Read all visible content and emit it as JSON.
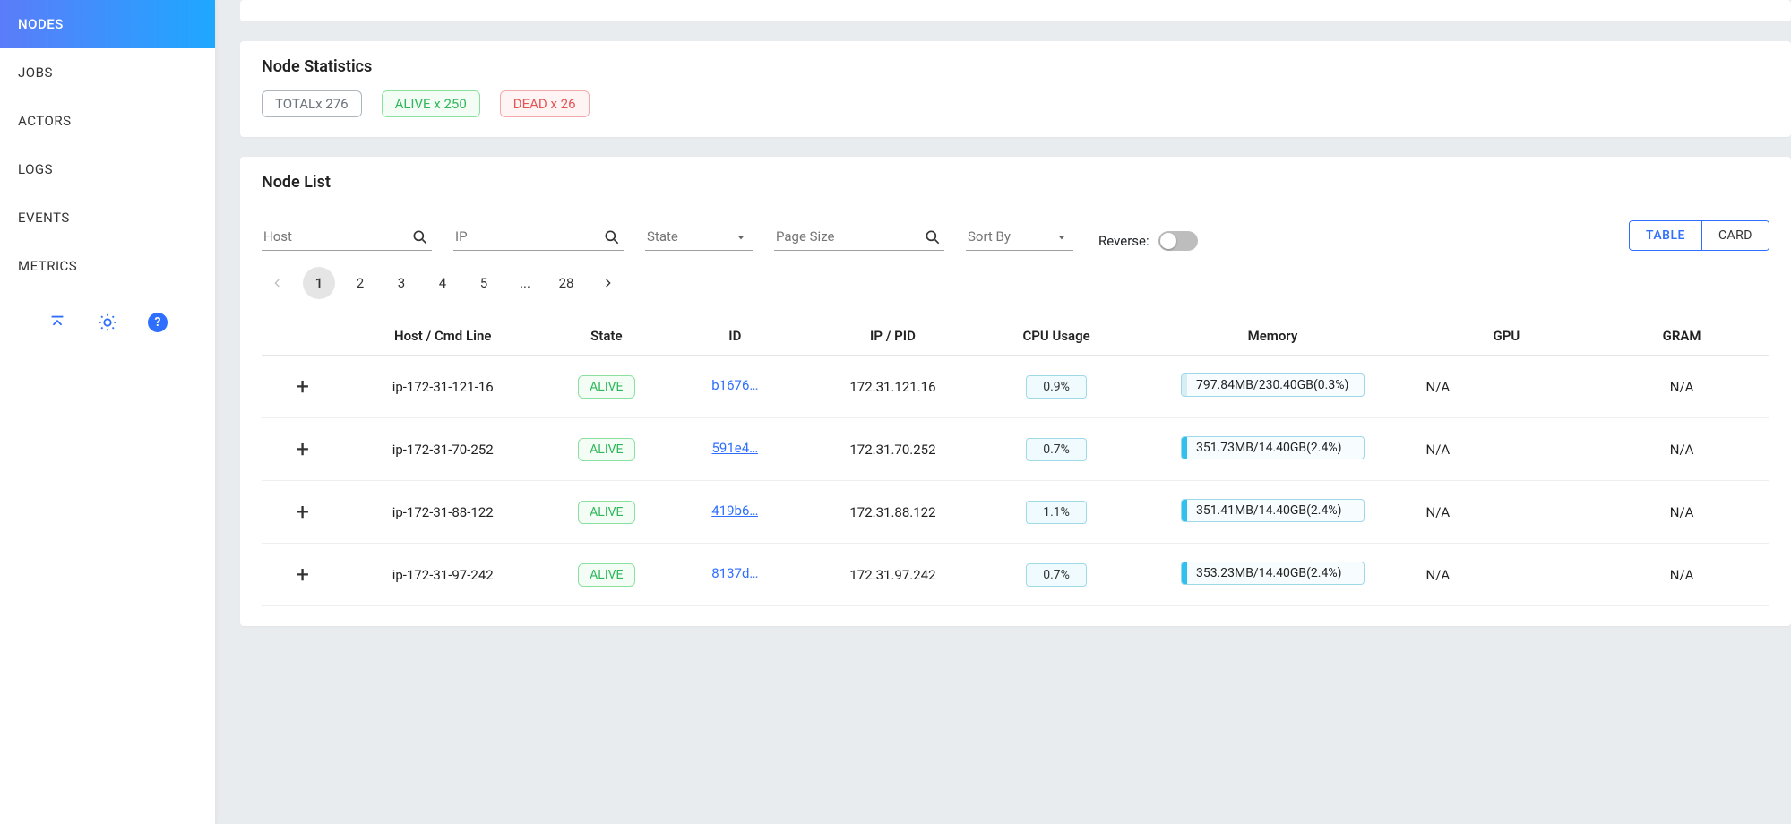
{
  "sidebar": {
    "items": [
      "NODES",
      "JOBS",
      "ACTORS",
      "LOGS",
      "EVENTS",
      "METRICS"
    ],
    "active": "NODES"
  },
  "stats": {
    "title": "Node Statistics",
    "total_label": "TOTALx 276",
    "alive_label": "ALIVE x 250",
    "dead_label": "DEAD x 26"
  },
  "list": {
    "title": "Node List",
    "filters": {
      "host_placeholder": "Host",
      "ip_placeholder": "IP",
      "state_placeholder": "State",
      "pagesize_placeholder": "Page Size",
      "sortby_placeholder": "Sort By",
      "reverse_label": "Reverse:",
      "view_table": "TABLE",
      "view_card": "CARD"
    },
    "pagination": {
      "pages": [
        "1",
        "2",
        "3",
        "4",
        "5",
        "...",
        "28"
      ],
      "current": "1"
    },
    "columns": {
      "host": "Host / Cmd Line",
      "state": "State",
      "id": "ID",
      "ip": "IP / PID",
      "cpu": "CPU Usage",
      "mem": "Memory",
      "gpu": "GPU",
      "gram": "GRAM"
    },
    "rows": [
      {
        "host": "ip-172-31-121-16",
        "state": "ALIVE",
        "id": "b1676…",
        "ip": "172.31.121.16",
        "cpu": "0.9%",
        "mem": "797.84MB/230.40GB(0.3%)",
        "mem_pct": 0.3,
        "gpu": "N/A",
        "gram": "N/A"
      },
      {
        "host": "ip-172-31-70-252",
        "state": "ALIVE",
        "id": "591e4…",
        "ip": "172.31.70.252",
        "cpu": "0.7%",
        "mem": "351.73MB/14.40GB(2.4%)",
        "mem_pct": 2.4,
        "gpu": "N/A",
        "gram": "N/A"
      },
      {
        "host": "ip-172-31-88-122",
        "state": "ALIVE",
        "id": "419b6…",
        "ip": "172.31.88.122",
        "cpu": "1.1%",
        "mem": "351.41MB/14.40GB(2.4%)",
        "mem_pct": 2.4,
        "gpu": "N/A",
        "gram": "N/A"
      },
      {
        "host": "ip-172-31-97-242",
        "state": "ALIVE",
        "id": "8137d…",
        "ip": "172.31.97.242",
        "cpu": "0.7%",
        "mem": "353.23MB/14.40GB(2.4%)",
        "mem_pct": 2.4,
        "gpu": "N/A",
        "gram": "N/A"
      }
    ]
  }
}
